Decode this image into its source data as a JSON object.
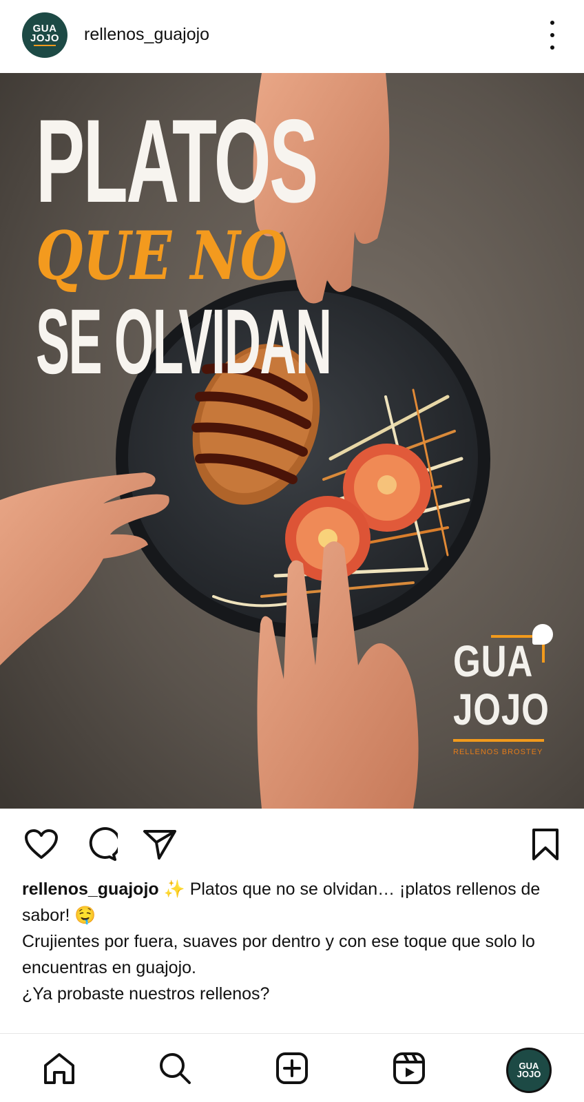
{
  "header": {
    "avatar_line1": "GUA",
    "avatar_line2": "JOJO",
    "username": "rellenos_guajojo",
    "more_icon": "vertical-ellipsis-icon"
  },
  "post": {
    "headline_line1": "PLATOS",
    "headline_line2": "QUE NO",
    "headline_line3": "SE OLVIDAN",
    "brand_line1": "GUA",
    "brand_line2": "JOJO",
    "brand_sub": "RELLENOS BROSTEY",
    "accent_color": "#f39a1e"
  },
  "actions": {
    "like_icon": "heart-icon",
    "comment_icon": "comment-icon",
    "share_icon": "send-icon",
    "save_icon": "bookmark-icon"
  },
  "caption": {
    "username": "rellenos_guajojo",
    "line1": " ✨ Platos que no se olvidan… ¡platos rellenos de sabor! 🤤",
    "line2": "Crujientes por fuera, suaves por dentro y con ese toque que solo lo encuentras en guajojo.",
    "line3": "¿Ya probaste nuestros rellenos?"
  },
  "bottom_nav": {
    "home_icon": "home-icon",
    "search_icon": "search-icon",
    "create_icon": "create-post-icon",
    "reels_icon": "reels-icon",
    "profile_line1": "GUA",
    "profile_line2": "JOJO"
  }
}
